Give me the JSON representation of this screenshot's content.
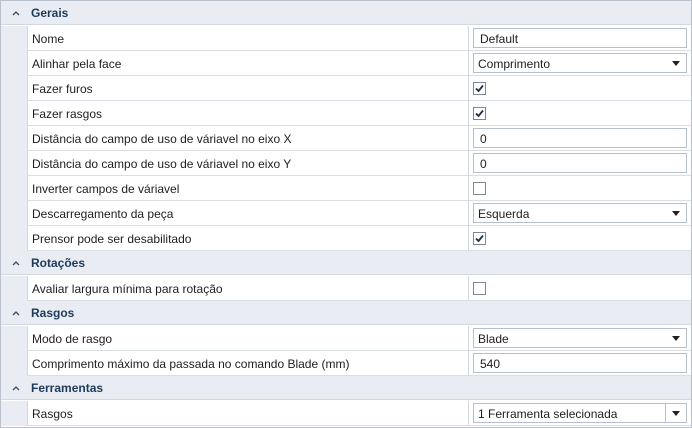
{
  "categories": {
    "gerais": "Gerais",
    "rotacoes": "Rotações",
    "rasgos": "Rasgos",
    "ferramentas": "Ferramentas"
  },
  "props": {
    "nome": {
      "label": "Nome",
      "value": "Default"
    },
    "alinhar": {
      "label": "Alinhar pela face",
      "value": "Comprimento"
    },
    "furos": {
      "label": "Fazer furos",
      "checked": true
    },
    "rasgos": {
      "label": "Fazer rasgos",
      "checked": true
    },
    "dist_x": {
      "label": "Distância do campo de uso de váriavel no eixo X",
      "value": "0"
    },
    "dist_y": {
      "label": "Distância do campo de uso de váriavel no eixo Y",
      "value": "0"
    },
    "inverter": {
      "label": "Inverter campos de váriavel",
      "checked": false
    },
    "descarregamento": {
      "label": "Descarregamento da peça",
      "value": "Esquerda"
    },
    "prensor": {
      "label": "Prensor pode ser desabilitado",
      "checked": true
    },
    "avaliar": {
      "label": "Avaliar largura mínima para rotação",
      "checked": false
    },
    "modo_rasgo": {
      "label": "Modo de rasgo",
      "value": "Blade"
    },
    "comp_max": {
      "label": "Comprimento máximo da passada no comando Blade (mm)",
      "value": "540"
    },
    "ferr_rasgos": {
      "label": "Rasgos",
      "value": "1 Ferramenta selecionada"
    }
  },
  "icons": {
    "collapse": "chevron-up-icon",
    "dropdown": "dropdown-arrow-icon",
    "check": "checkmark-icon"
  }
}
